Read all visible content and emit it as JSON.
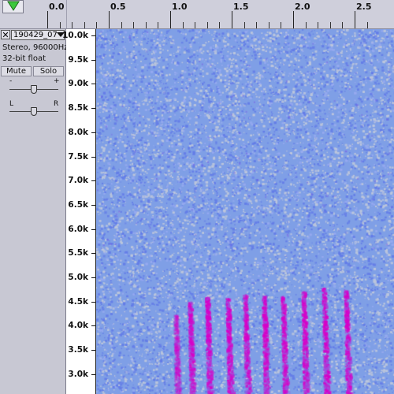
{
  "ruler": {
    "ticks": [
      "0.0",
      "0.5",
      "1.0",
      "1.5",
      "2.0",
      "2.5"
    ],
    "tick_values": [
      0.0,
      0.5,
      1.0,
      1.5,
      2.0,
      2.5
    ]
  },
  "track": {
    "close_symbol": "✕",
    "name": "190429_07",
    "info_line1": "Stereo, 96000Hz",
    "info_line2": "32-bit float",
    "mute_label": "Mute",
    "solo_label": "Solo",
    "gain_minus": "-",
    "gain_plus": "+",
    "pan_left": "L",
    "pan_right": "R",
    "gain_level": 0.5,
    "pan_level": 0.5
  },
  "freq_axis": {
    "labels": [
      "10.0k",
      "9.5k",
      "9.0k",
      "8.5k",
      "8.0k",
      "7.5k",
      "7.0k",
      "6.5k",
      "6.0k",
      "5.5k",
      "5.0k",
      "4.5k",
      "4.0k",
      "3.5k",
      "3.0k"
    ],
    "values_khz": [
      10.0,
      9.5,
      9.0,
      8.5,
      8.0,
      7.5,
      7.0,
      6.5,
      6.0,
      5.5,
      5.0,
      4.5,
      4.0,
      3.5,
      3.0
    ]
  },
  "colors": {
    "spectro_base": "#7f9fe6",
    "spectro_noise_light": "#b4c4e0",
    "spectro_noise_dark": "#6f88e8",
    "call_magenta": "#d800c8",
    "call_purple": "#9a52e0"
  },
  "icons": {
    "play_head": "green-down-triangle-icon",
    "dropdown": "triangle-down-icon",
    "close": "close-icon"
  }
}
